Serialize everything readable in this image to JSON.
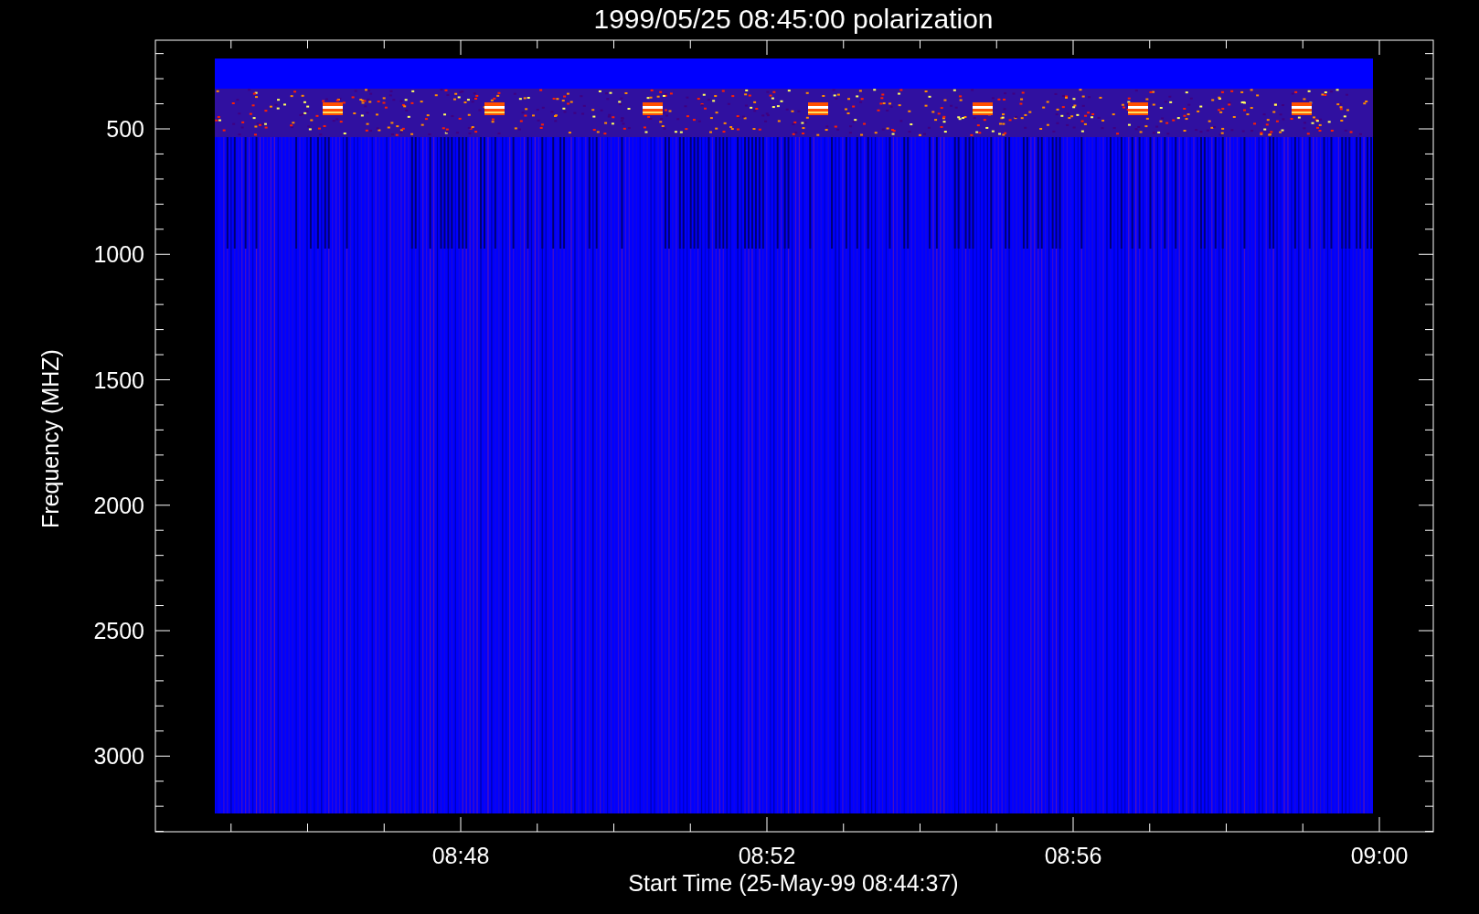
{
  "title": "1999/05/25 08:45:00 polarization",
  "y_axis": {
    "label": "Frequency (MHZ)",
    "ticks": [
      "500",
      "1000",
      "1500",
      "2000",
      "2500",
      "3000"
    ]
  },
  "x_axis": {
    "label": "Start Time (25-May-99 08:44:37)",
    "ticks": [
      "08:48",
      "08:52",
      "08:56",
      "09:00"
    ]
  }
}
